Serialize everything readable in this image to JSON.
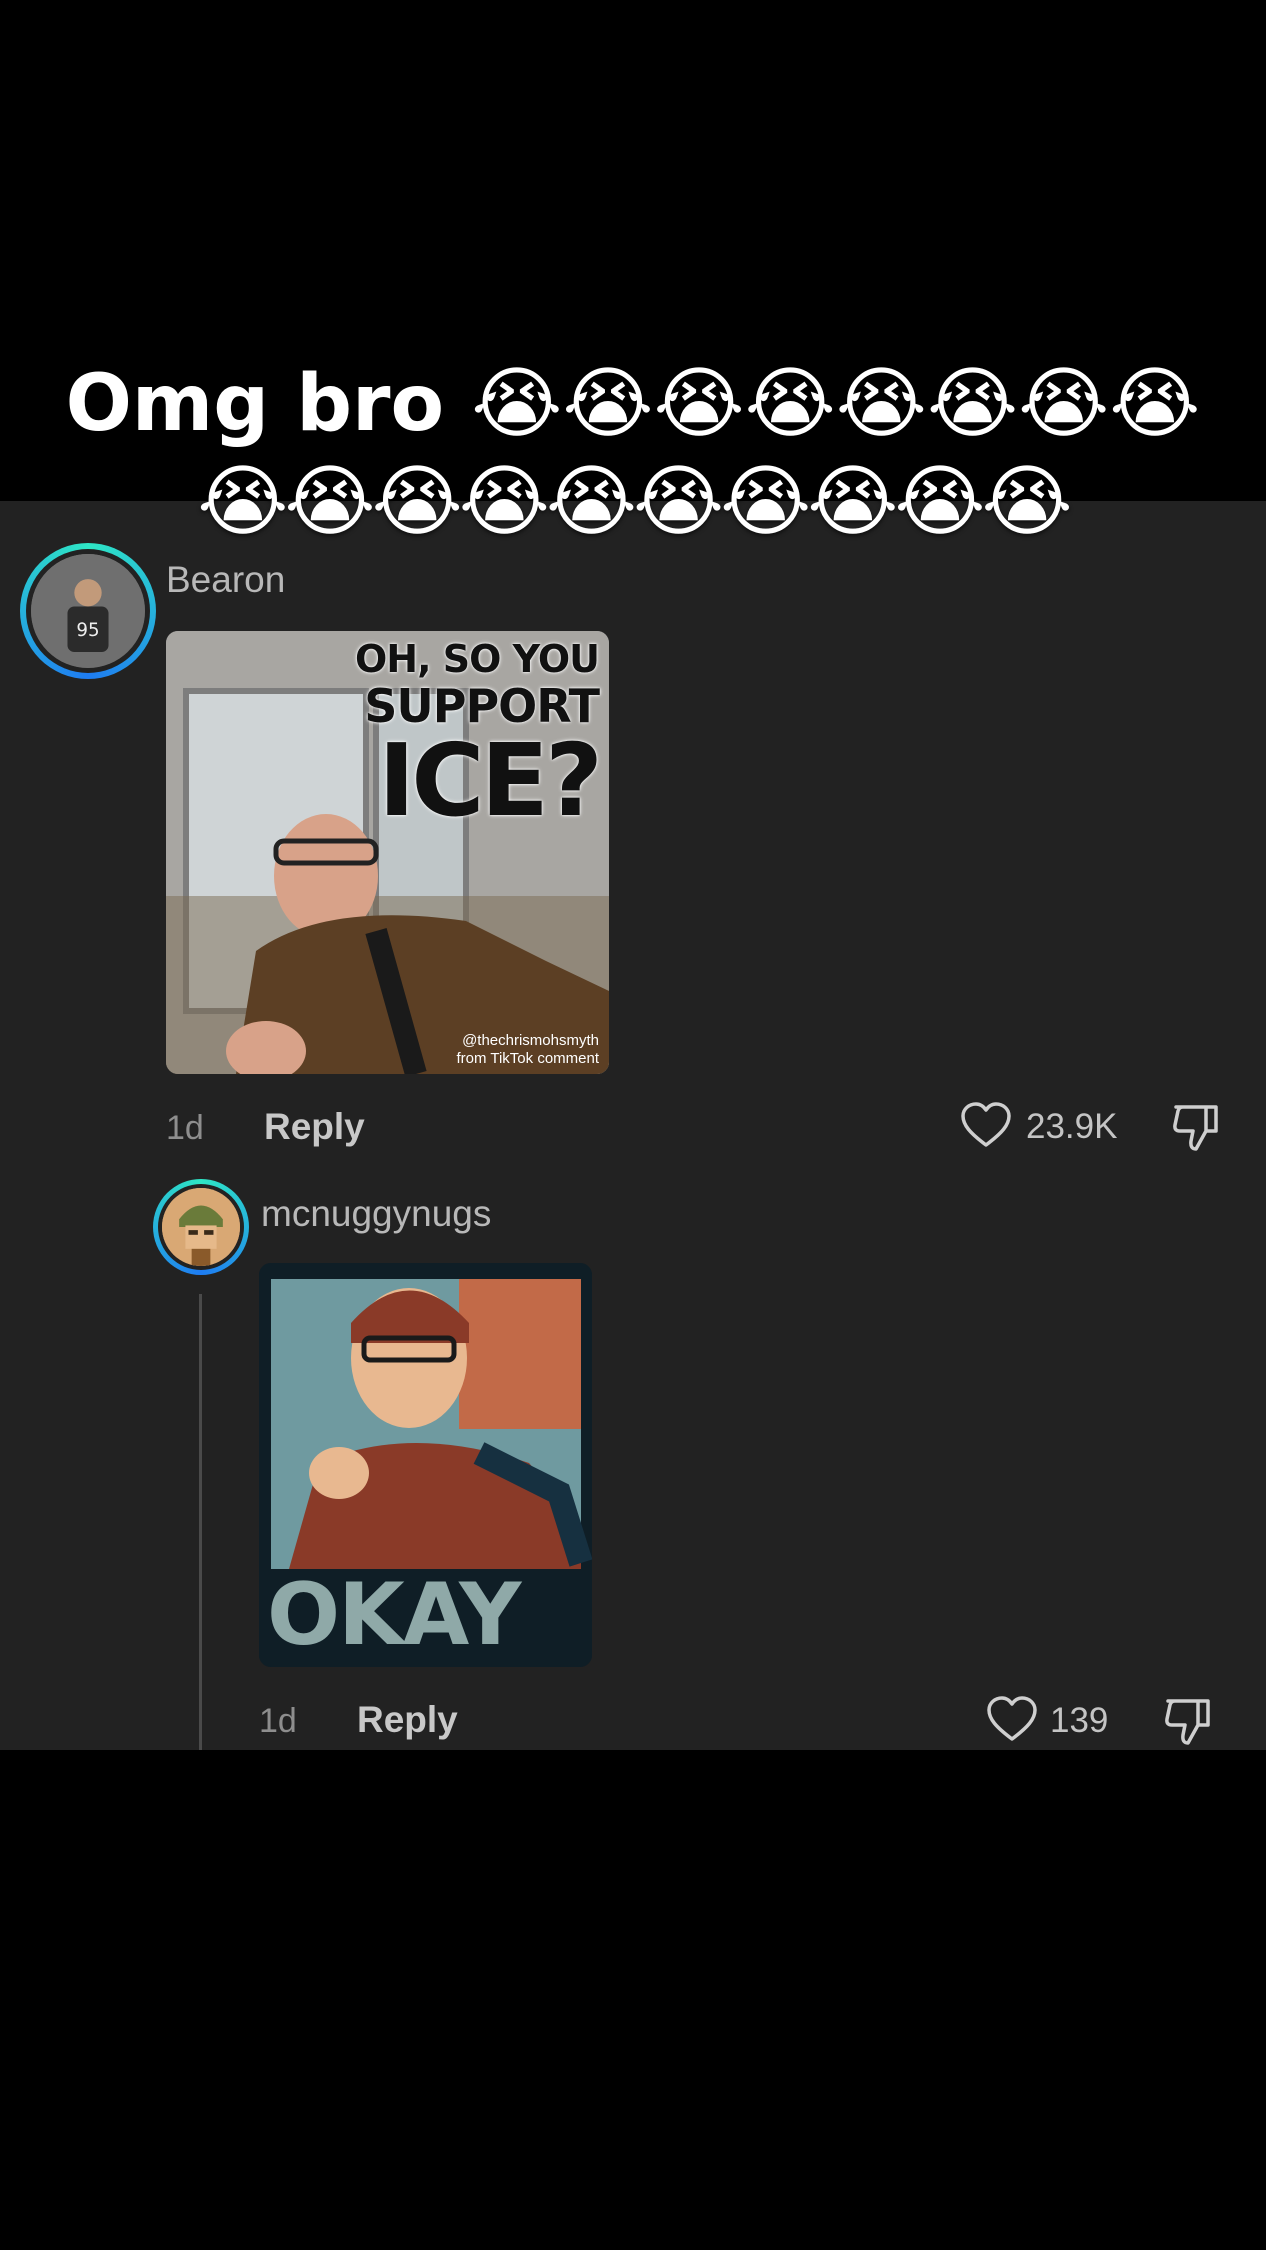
{
  "caption": {
    "line1": "Omg bro 😭😭😭😭😭😭😭😭",
    "line2": "😭😭😭😭😭😭😭😭😭😭"
  },
  "comments": [
    {
      "username": "Bearon",
      "time": "1d",
      "reply_label": "Reply",
      "likes": "23.9K",
      "media": {
        "line1": "OH, SO YOU",
        "line2": "SUPPORT",
        "line3": "ICE?",
        "handle": "@thechrismohsmyth",
        "source": "from TikTok comment"
      },
      "avatar_icon": "user-avatar"
    },
    {
      "username": "mcnuggynugs",
      "time": "1d",
      "reply_label": "Reply",
      "likes": "139",
      "media": {
        "caption": "OKAY"
      },
      "avatar_icon": "user-avatar"
    }
  ],
  "colors": {
    "background": "#000000",
    "panel": "#222222",
    "avatar_ring_start": "#2ee6c5",
    "avatar_ring_end": "#1e7cf2"
  },
  "icons": [
    "heart-icon",
    "dislike-icon"
  ]
}
